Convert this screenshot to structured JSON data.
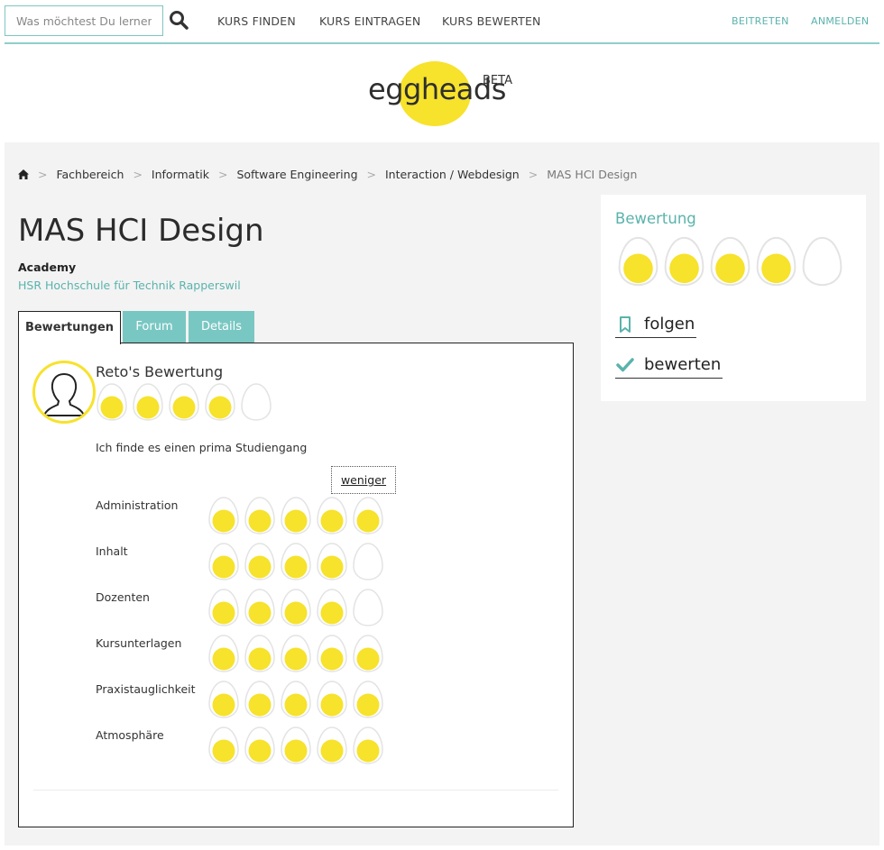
{
  "header": {
    "search": {
      "placeholder": "Was möchtest Du lernen?"
    },
    "nav": [
      "KURS FINDEN",
      "KURS EINTRAGEN",
      "KURS BEWERTEN"
    ],
    "join": "BEITRETEN",
    "login": "ANMELDEN"
  },
  "logo": {
    "text": "eggheads",
    "badge": "BETA"
  },
  "breadcrumb": [
    "Fachbereich",
    "Informatik",
    "Software Engineering",
    "Interaction / Webdesign",
    "MAS HCI Design"
  ],
  "course": {
    "title": "MAS HCI Design",
    "provider_type": "Academy",
    "provider_name": "HSR Hochschule für Technik Rapperswil"
  },
  "tabs": [
    "Bewertungen",
    "Forum",
    "Details"
  ],
  "review": {
    "title": "Reto's Bewertung",
    "overall": 4,
    "max": 5,
    "text": "Ich finde es einen prima Studiengang",
    "less_label": "weniger",
    "criteria": [
      {
        "label": "Administration",
        "value": 5
      },
      {
        "label": "Inhalt",
        "value": 4
      },
      {
        "label": "Dozenten",
        "value": 4
      },
      {
        "label": "Kursunterlagen",
        "value": 5
      },
      {
        "label": "Praxistauglichkeit",
        "value": 5
      },
      {
        "label": "Atmosphäre",
        "value": 5
      }
    ]
  },
  "sidebar": {
    "title": "Bewertung",
    "rating": 4,
    "max": 5,
    "follow_label": "folgen",
    "rate_label": "bewerten"
  },
  "colors": {
    "accent": "#5ab3ac",
    "egg_yolk": "#f7e22c",
    "tab": "#79c7c2"
  }
}
